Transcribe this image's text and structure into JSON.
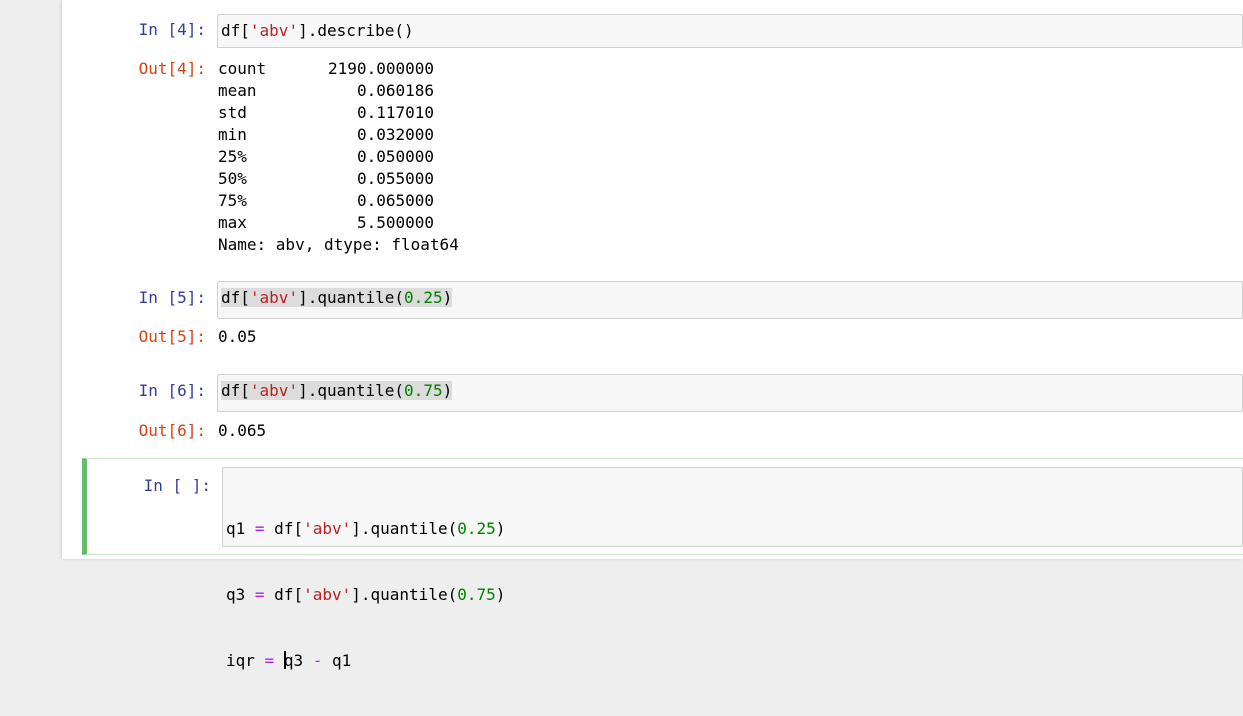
{
  "cells": {
    "c4": {
      "in_prompt": "In [4]:",
      "code_prefix": "df[",
      "code_str": "'abv'",
      "code_suffix": "].describe()",
      "out_prompt": "Out[4]:",
      "stats": [
        {
          "key": "count",
          "value": "2190.000000"
        },
        {
          "key": "mean",
          "value": "0.060186"
        },
        {
          "key": "std",
          "value": "0.117010"
        },
        {
          "key": "min",
          "value": "0.032000"
        },
        {
          "key": "25%",
          "value": "0.050000"
        },
        {
          "key": "50%",
          "value": "0.055000"
        },
        {
          "key": "75%",
          "value": "0.065000"
        },
        {
          "key": "max",
          "value": "5.500000"
        }
      ],
      "footer": "Name: abv, dtype: float64"
    },
    "c5": {
      "in_prompt": "In [5]:",
      "code_prefix": "df[",
      "code_str": "'abv'",
      "code_mid": "].quantile(",
      "code_num": "0.25",
      "code_suffix": ")",
      "out_prompt": "Out[5]:",
      "output": "0.05"
    },
    "c6": {
      "in_prompt": "In [6]:",
      "code_prefix": "df[",
      "code_str": "'abv'",
      "code_mid": "].quantile(",
      "code_num": "0.75",
      "code_suffix": ")",
      "out_prompt": "Out[6]:",
      "output": "0.065"
    },
    "c7": {
      "in_prompt": "In [ ]:",
      "line1": {
        "var": "q1 ",
        "op": "=",
        "pre": " df[",
        "str": "'abv'",
        "mid": "].quantile(",
        "num": "0.25",
        "end": ")"
      },
      "line2": {
        "var": "q3 ",
        "op": "=",
        "pre": " df[",
        "str": "'abv'",
        "mid": "].quantile(",
        "num": "0.75",
        "end": ")"
      },
      "line3": {
        "var": "iqr ",
        "op": "=",
        "before_cursor": " ",
        "after_cursor": "q3 ",
        "op2": "-",
        "end": " q1"
      }
    }
  }
}
